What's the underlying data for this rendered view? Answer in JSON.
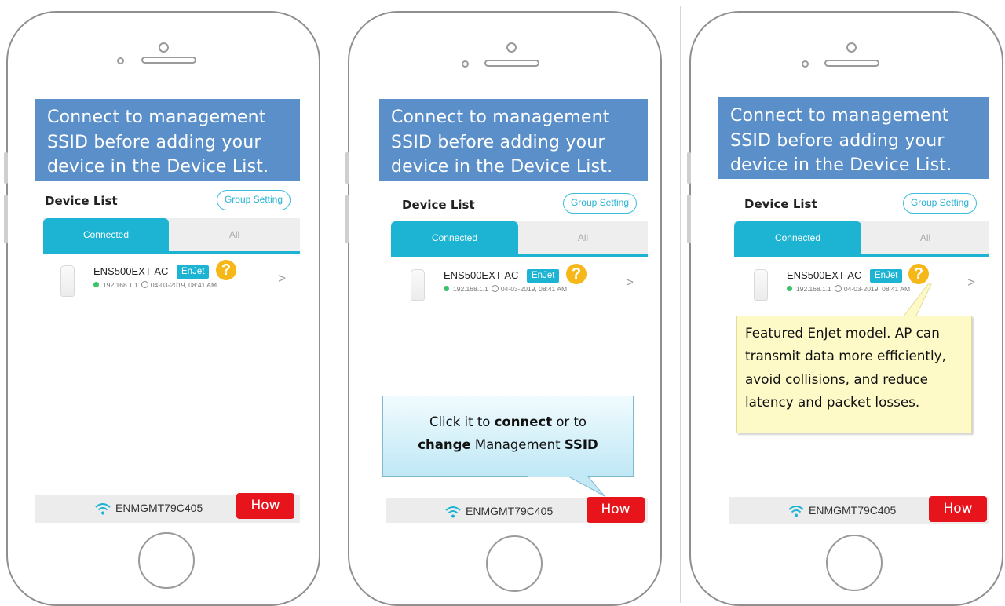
{
  "banner_text": "Connect to management SSID before adding your device in the Device List.",
  "device_list": {
    "title": "Device List",
    "group_setting_label": "Group Setting",
    "tabs": {
      "connected": "Connected",
      "all": "All"
    }
  },
  "device": {
    "name": "ENS500EXT-AC",
    "badge": "EnJet",
    "help_glyph": "?",
    "ip": "192.168.1.1",
    "timestamp": "04-03-2019, 08:41 AM",
    "chevron": ">"
  },
  "bottom_bar": {
    "ssid": "ENMGMT79C405",
    "how_label": "How"
  },
  "callout": {
    "part1": "Click it to ",
    "bold1": "connect",
    "part2": " or to",
    "bold2": "change",
    "part3": " Management ",
    "bold3": "SSID"
  },
  "note_text": "Featured EnJet model. AP can transmit data more efficiently, avoid collisions, and reduce latency and packet losses.",
  "colors": {
    "banner": "#5b8fc9",
    "accent": "#1db4d4",
    "how_button": "#e8141c",
    "help_badge": "#f6b818",
    "status_online": "#3cc26b"
  },
  "icons": [
    "wifi-icon",
    "clock-icon",
    "chevron-right-icon",
    "help-icon",
    "home-button-icon",
    "camera-icon",
    "speaker-icon"
  ]
}
